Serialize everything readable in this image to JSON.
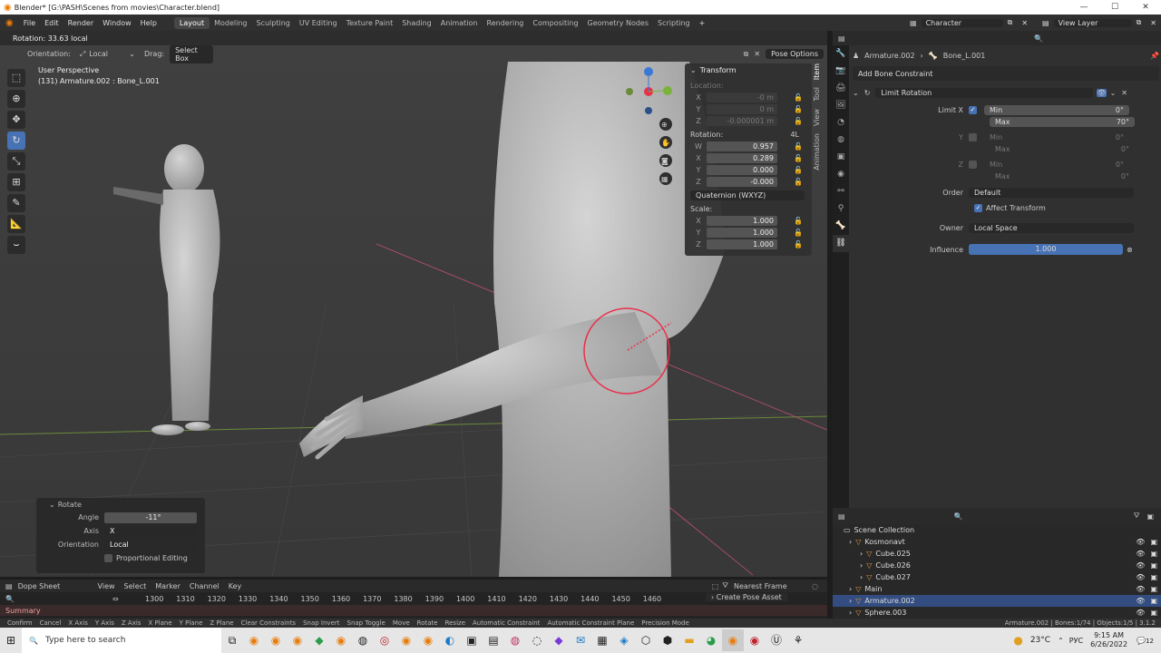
{
  "window": {
    "title": "Blender* [G:\\PASH\\Scenes from movies\\Character.blend]",
    "min": "—",
    "max": "☐",
    "close": "✕"
  },
  "menu": {
    "items": [
      "File",
      "Edit",
      "Render",
      "Window",
      "Help"
    ],
    "workspaces": [
      "Layout",
      "Modeling",
      "Sculpting",
      "UV Editing",
      "Texture Paint",
      "Shading",
      "Animation",
      "Rendering",
      "Compositing",
      "Geometry Nodes",
      "Scripting"
    ],
    "add": "+",
    "scene": "Character",
    "view_layer": "View Layer"
  },
  "viewport": {
    "status": "Rotation: 33.63 local",
    "orientation_label": "Orientation:",
    "orientation_value": "Local",
    "drag_label": "Drag:",
    "drag_value": "Select Box",
    "pose_options": "Pose Options",
    "perspective": "User Perspective",
    "active": "(131) Armature.002 : Bone_L.001"
  },
  "npanel": {
    "header": "Transform",
    "location_label": "Location:",
    "location": [
      {
        "axis": "X",
        "value": "-0 m"
      },
      {
        "axis": "Y",
        "value": "0 m"
      },
      {
        "axis": "Z",
        "value": "-0.000001 m"
      }
    ],
    "rotation_label": "Rotation:",
    "rotation_4l": "4L",
    "rotation": [
      {
        "axis": "W",
        "value": "0.957"
      },
      {
        "axis": "X",
        "value": "0.289"
      },
      {
        "axis": "Y",
        "value": "0.000"
      },
      {
        "axis": "Z",
        "value": "-0.000"
      }
    ],
    "rotation_mode": "Quaternion (WXYZ)",
    "scale_label": "Scale:",
    "scale": [
      {
        "axis": "X",
        "value": "1.000"
      },
      {
        "axis": "Y",
        "value": "1.000"
      },
      {
        "axis": "Z",
        "value": "1.000"
      }
    ],
    "tabs": [
      "Item",
      "Tool",
      "View",
      "Animation"
    ]
  },
  "rotate_panel": {
    "title": "Rotate",
    "angle_label": "Angle",
    "angle": "-11°",
    "axis_label": "Axis",
    "axis": "X",
    "orientation_label": "Orientation",
    "orientation": "Local",
    "prop_edit": "Proportional Editing"
  },
  "properties": {
    "breadcrumb_obj": "Armature.002",
    "breadcrumb_bone": "Bone_L.001",
    "add_constraint": "Add Bone Constraint",
    "constraint_name": "Limit Rotation",
    "limit_x": "Limit X",
    "min_label": "Min",
    "min_x": "0°",
    "max_label": "Max",
    "max_x": "70°",
    "y_label": "Y",
    "min_y": "0°",
    "max_y": "0°",
    "z_label": "Z",
    "min_z": "0°",
    "max_z": "0°",
    "order_label": "Order",
    "order_value": "Default",
    "affect_transform": "Affect Transform",
    "owner_label": "Owner",
    "owner_value": "Local Space",
    "influence_label": "Influence",
    "influence_value": "1.000",
    "influence_fraction": 1.0
  },
  "outliner": {
    "scene_collection": "Scene Collection",
    "rows": [
      {
        "name": "Kosmonavt",
        "indent": 1,
        "sel": false
      },
      {
        "name": "Cube.025",
        "indent": 2,
        "sel": false
      },
      {
        "name": "Cube.026",
        "indent": 2,
        "sel": false
      },
      {
        "name": "Cube.027",
        "indent": 2,
        "sel": false
      },
      {
        "name": "Main",
        "indent": 1,
        "sel": false
      },
      {
        "name": "Armature.002",
        "indent": 1,
        "sel": true
      },
      {
        "name": "Sphere.003",
        "indent": 1,
        "sel": false
      }
    ]
  },
  "timeline": {
    "editor": "Dope Sheet",
    "menus": [
      "View",
      "Select",
      "Marker",
      "Channel",
      "Key"
    ],
    "snap": "Nearest Frame",
    "frames": [
      "1300",
      "1310",
      "1320",
      "1330",
      "1340",
      "1350",
      "1360",
      "1370",
      "1380",
      "1390",
      "1400",
      "1410",
      "1420",
      "1430",
      "1440",
      "1450",
      "1460"
    ],
    "summary": "Summary",
    "create_pose": "Create Pose Asset"
  },
  "statusbar": {
    "items": [
      "Confirm",
      "Cancel",
      "X Axis",
      "Y Axis",
      "Z Axis",
      "X Plane",
      "Y Plane",
      "Z Plane",
      "Clear Constraints",
      "Snap Invert",
      "Snap Toggle",
      "Move",
      "Rotate",
      "Resize",
      "Automatic Constraint",
      "Automatic Constraint Plane",
      "Precision Mode"
    ],
    "stats": "Armature.002 | Bones:1/74 | Objects:1/5 | 3.1.2"
  },
  "taskbar": {
    "search": "Type here to search",
    "weather": "23°C",
    "lang": "РУС",
    "time": "9:15 AM",
    "date": "6/26/2022",
    "notif": "12"
  },
  "colors": {
    "accent": "#4772b3",
    "selected": "#334d80",
    "gizmo": "#e8304a"
  }
}
